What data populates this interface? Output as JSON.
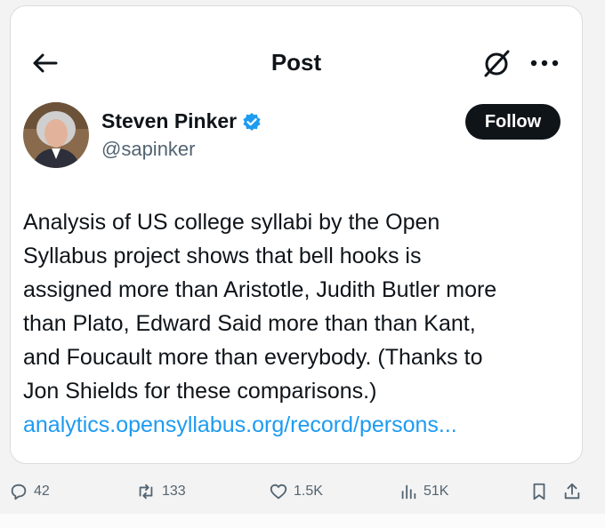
{
  "header": {
    "title": "Post"
  },
  "author": {
    "name": "Steven Pinker",
    "handle": "@sapinker",
    "verified": true,
    "follow_label": "Follow"
  },
  "post": {
    "text": "Analysis of US college syllabi by the Open\nSyllabus project shows that bell hooks is\nassigned more than Aristotle, Judith Butler more\nthan Plato, Edward Said more than  than Kant,\nand Foucault more than everybody. (Thanks to\nJon Shields for these comparisons.)",
    "link": "analytics.opensyllabus.org/record/persons..."
  },
  "actions": {
    "replies": "42",
    "reposts": "133",
    "likes": "1.5K",
    "views": "51K"
  },
  "icons": {
    "back": "arrow-left-icon",
    "grok": "grok-icon",
    "more": "more-icon",
    "verified": "verified-badge-icon",
    "reply": "reply-icon",
    "repost": "repost-icon",
    "like": "heart-icon",
    "views": "views-icon",
    "bookmark": "bookmark-icon",
    "share": "share-icon"
  },
  "colors": {
    "link": "#1d9bf0",
    "verified": "#1d9bf0",
    "follow_bg": "#0f1419",
    "muted": "#536471"
  }
}
